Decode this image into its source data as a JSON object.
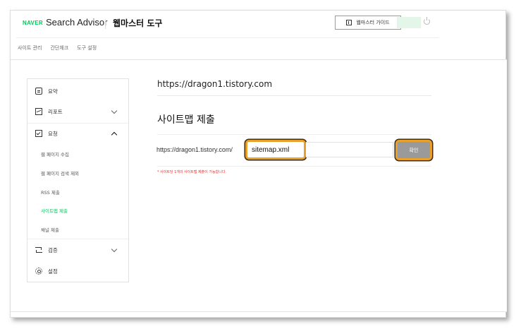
{
  "header": {
    "brand": "NAVER",
    "product": "Search Advisor",
    "tool_title": "웹마스터 도구",
    "guide_button": "웹마스터 가이드"
  },
  "tabs": [
    {
      "label": "사이트 관리"
    },
    {
      "label": "간단체크"
    },
    {
      "label": "도구 설정"
    }
  ],
  "sidebar": {
    "items": [
      {
        "label": "요약",
        "icon": "summary-icon"
      },
      {
        "label": "리포트",
        "icon": "report-icon",
        "expandable": true
      },
      {
        "label": "요청",
        "icon": "request-icon",
        "expanded": true
      },
      {
        "label": "검증",
        "icon": "verify-icon",
        "expandable": true
      },
      {
        "label": "설정",
        "icon": "settings-icon"
      }
    ],
    "request_subitems": [
      {
        "label": "웹 페이지 수집"
      },
      {
        "label": "웹 페이지 검색 제외"
      },
      {
        "label": "RSS 제출"
      },
      {
        "label": "사이트맵 제출",
        "active": true
      },
      {
        "label": "채널 제출"
      }
    ]
  },
  "main": {
    "site_url": "https://dragon1.tistory.com",
    "section_title": "사이트맵 제출",
    "url_prefix": "https://dragon1.tistory.com/",
    "sitemap_value": "sitemap.xml",
    "confirm_label": "확인",
    "note": "* 사이트당 1개의 사이트맵 제출이 가능합니다."
  },
  "colors": {
    "brand_green": "#03c75a",
    "highlight_orange": "#e8a02a",
    "note_red": "#e0322f",
    "button_gray": "#9a9a9a"
  }
}
